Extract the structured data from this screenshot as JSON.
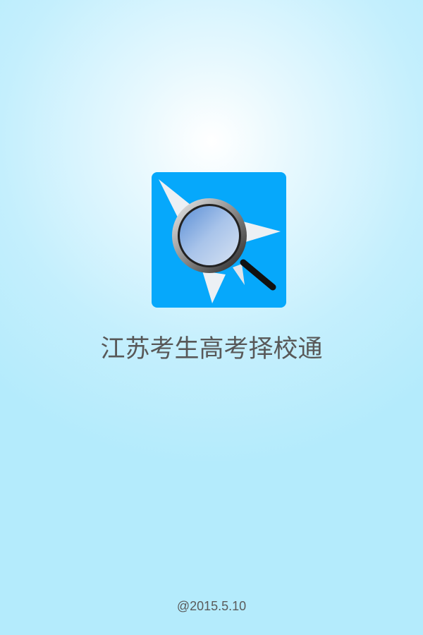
{
  "splash": {
    "app_icon": "magnifier-compass-icon",
    "title": "江苏考生高考择校通",
    "footer": "@2015.5.10"
  },
  "colors": {
    "icon_bg": "#06a8fb",
    "text": "#585858",
    "background": "#b4ebfc"
  }
}
